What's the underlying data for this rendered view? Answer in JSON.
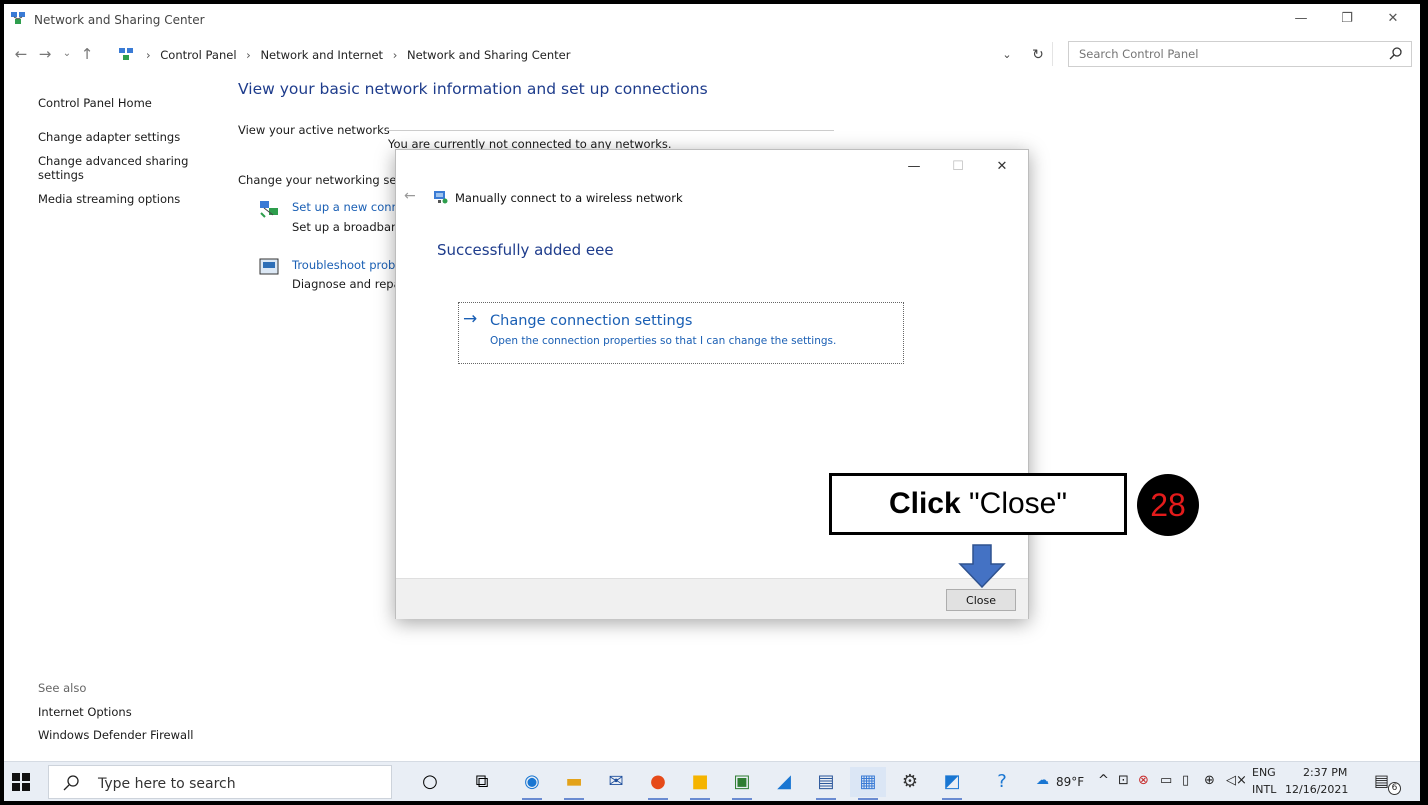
{
  "window": {
    "title": "Network and Sharing Center",
    "minimize": "—",
    "restore": "❐",
    "close": "✕"
  },
  "address_bar": {
    "breadcrumb": [
      "Control Panel",
      "Network and Internet",
      "Network and Sharing Center"
    ],
    "search_placeholder": "Search Control Panel"
  },
  "left_pane": {
    "links": [
      "Control Panel Home",
      "Change adapter settings",
      "Change advanced sharing settings",
      "Media streaming options"
    ],
    "see_also_label": "See also",
    "see_also_links": [
      "Internet Options",
      "Windows Defender Firewall"
    ]
  },
  "main": {
    "heading": "View your basic network information and set up connections",
    "active_networks_label": "View your active networks",
    "not_connected_text": "You are currently not connected to any networks.",
    "change_settings_label": "Change your networking sett",
    "tasks": [
      {
        "link": "Set up a new conn",
        "desc": "Set up a broadband"
      },
      {
        "link": "Troubleshoot probl",
        "desc": "Diagnose and repa"
      }
    ]
  },
  "dialog": {
    "title": "Manually connect to a wireless network",
    "success_message": "Successfully added eee",
    "command_link_main": "Change connection settings",
    "command_link_sub": "Open the connection properties so that I can change the settings.",
    "close_button": "Close",
    "minimize": "—",
    "maximize": "☐",
    "close": "✕"
  },
  "annotation": {
    "callout_bold": "Click",
    "callout_rest": " \"Close\"",
    "step_number": "28",
    "arrow_color": "#4472c4",
    "badge_number_color": "#e31b1b"
  },
  "taskbar": {
    "search_placeholder": "Type here to search",
    "weather": "89°F",
    "language_top": "ENG",
    "language_bottom": "INTL",
    "time": "2:37 PM",
    "date": "12/16/2021",
    "notification_count": "6"
  },
  "colors": {
    "heading_blue": "#1e3c8c",
    "link_blue": "#1a5fb4"
  }
}
